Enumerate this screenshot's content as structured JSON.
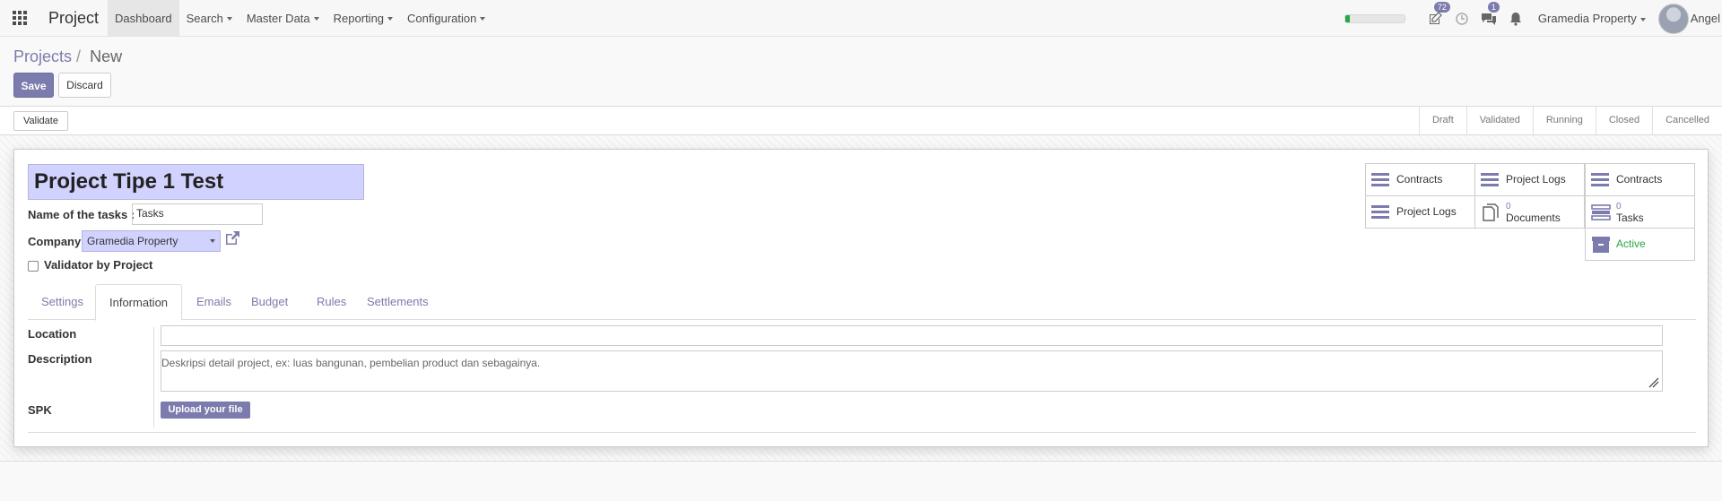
{
  "navbar": {
    "app_name": "Project",
    "menu": [
      {
        "label": "Dashboard",
        "has_caret": false,
        "active": true
      },
      {
        "label": "Search",
        "has_caret": true
      },
      {
        "label": "Master Data",
        "has_caret": true
      },
      {
        "label": "Reporting",
        "has_caret": true
      },
      {
        "label": "Configuration",
        "has_caret": true
      }
    ],
    "activity_badge": "72",
    "messages_badge": "1",
    "company": "Gramedia Property",
    "user_name": "Angel",
    "progress_fraction": 0.08,
    "progress_color": "#27a745"
  },
  "breadcrumb": {
    "parent": "Projects",
    "separator": "/",
    "current": "New"
  },
  "actions": {
    "save_label": "Save",
    "discard_label": "Discard"
  },
  "statusbar": {
    "validate_label": "Validate",
    "stages": [
      "Draft",
      "Validated",
      "Running",
      "Closed",
      "Cancelled"
    ]
  },
  "form": {
    "project_name": "Project Tipe 1 Test",
    "tasks_label": "Name of the tasks :",
    "tasks_value": "Tasks",
    "company_label": "Company",
    "company_value": "Gramedia Property",
    "validator_label": "Validator by Project",
    "validator_checked": false
  },
  "smart_buttons": {
    "contracts_1": "Contracts",
    "project_logs_1": "Project Logs",
    "contracts_2": "Contracts",
    "project_logs_2": "Project Logs",
    "documents_count": "0",
    "documents_label": "Documents",
    "tasks_count": "0",
    "tasks_label": "Tasks",
    "active_label": "Active"
  },
  "tabs": [
    "Settings",
    "Information",
    "Emails",
    "Budget",
    "Rules",
    "Settlements"
  ],
  "active_tab": "Information",
  "information": {
    "location_label": "Location",
    "location_value": "",
    "description_label": "Description",
    "description_placeholder": "Deskripsi detail project, ex: luas bangunan, pembelian product dan sebagainya.",
    "spk_label": "SPK",
    "upload_label": "Upload your file"
  },
  "colors": {
    "brand": "#7c7bad",
    "required_field": "#d2d2ff",
    "active_green": "#28a745"
  }
}
